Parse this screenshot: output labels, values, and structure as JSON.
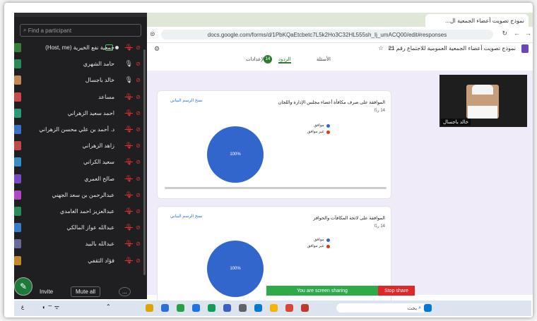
{
  "zoom": {
    "search_placeholder": "Find a participant",
    "participants": [
      {
        "name": "جمعية نفع الخيرية (Host, me)",
        "color": "#3a7d3a",
        "mic": "host"
      },
      {
        "name": "حامد الشهري",
        "color": "#2a8a5a",
        "mic": "on"
      },
      {
        "name": "خالد باجسال",
        "color": "#c2885a",
        "mic": "on"
      },
      {
        "name": "مساعد",
        "color": "#c94a4a",
        "mic": "off"
      },
      {
        "name": "احمد سعيد الزهراني",
        "color": "#2a9a7a",
        "mic": "off"
      },
      {
        "name": "د. أحمد بن علي محسن الزهراني",
        "color": "#3a6fc2",
        "mic": "off"
      },
      {
        "name": "زاهد الزهراني",
        "color": "#c24a4a",
        "mic": "off"
      },
      {
        "name": "سعيد الكراني",
        "color": "#3a8fc2",
        "mic": "off"
      },
      {
        "name": "صالح العمري",
        "color": "#7a4ac2",
        "mic": "off"
      },
      {
        "name": "عبدالرحمن بن سعد الجهني",
        "color": "#b04ac2",
        "mic": "off"
      },
      {
        "name": "عبدالعزيز احمد الغامدي",
        "color": "#2a8a5a",
        "mic": "off"
      },
      {
        "name": "عبدالله عواز المالكي",
        "color": "#3a7dc2",
        "mic": "off"
      },
      {
        "name": "عبدالله بالبيد",
        "color": "#6a6a9a",
        "mic": "off"
      },
      {
        "name": "فؤاد الثقفي",
        "color": "#c2882a",
        "mic": "off"
      }
    ],
    "invite_label": "Invite",
    "mute_all_label": "Mute all",
    "more_label": "..."
  },
  "browser": {
    "tab_title": "نموذج تصويت أعضاء الجمعية ال...",
    "url": "docs.google.com/forms/d/1PbKQaEtcbetc7L5k2Ho3C32HL555sh_Ij_umACQ00/edit#responses",
    "form_title": "نموذج تصويت أعضاء الجمعية العمومية للاجتماع رقم 21",
    "tabs": [
      "الأسئلة",
      "الردود",
      "الإعدادات"
    ],
    "responses_badge": "14"
  },
  "cards": [
    {
      "title": "الموافقة على صرف مكافأة أعضاء مجلس الإدارة واللجان",
      "count": "14 ردًا",
      "copy_label": "نسخ الرسم البياني",
      "legend": [
        "موافق",
        "غير موافق"
      ],
      "pct_label": "100%"
    },
    {
      "title": "الموافقة على لائحة المكافآت والحوافز",
      "count": "14 ردًا",
      "copy_label": "نسخ الرسم البياني",
      "legend": [
        "موافق",
        "غير موافق"
      ],
      "pct_label": "100%"
    }
  ],
  "chart_data": [
    {
      "type": "pie",
      "categories": [
        "موافق",
        "غير موافق"
      ],
      "values": [
        100,
        0
      ],
      "title": "الموافقة على صرف مكافأة أعضاء مجلس الإدارة واللجان"
    },
    {
      "type": "pie",
      "categories": [
        "موافق",
        "غير موافق"
      ],
      "values": [
        100,
        0
      ],
      "title": "الموافقة على لائحة المكافآت والحوافز"
    }
  ],
  "colors": {
    "yes": "#3366cc",
    "no": "#dc3912"
  },
  "video": {
    "name": "خالد باجسال"
  },
  "share": {
    "text": "You are screen sharing",
    "stop": "Stop share"
  },
  "taskbar": {
    "search": "بحث",
    "lang": "ع"
  }
}
